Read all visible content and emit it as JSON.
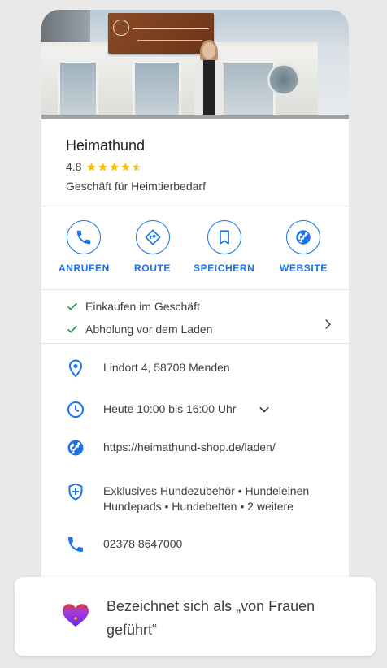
{
  "business": {
    "name": "Heimathund",
    "rating": "4.8",
    "rating_value": 4.8,
    "rating_max": 5,
    "category": "Geschäft für Heimtierbedarf"
  },
  "actions": [
    {
      "label": "ANRUFEN",
      "icon": "phone-icon"
    },
    {
      "label": "ROUTE",
      "icon": "directions-icon"
    },
    {
      "label": "SPEICHERN",
      "icon": "bookmark-icon"
    },
    {
      "label": "WEBSITE",
      "icon": "globe-icon"
    }
  ],
  "services": [
    "Einkaufen im Geschäft",
    "Abholung vor dem Laden"
  ],
  "info": {
    "address": "Lindort 4, 58708 Menden",
    "hours": "Heute 10:00 bis 16:00 Uhr",
    "website": "https://heimathund-shop.de/laden/",
    "products_line1": "Exklusives Hundezubehör • Hundeleinen",
    "products_line2": "Hundepads • Hundebetten • 2 weitere",
    "phone": "02378 8647000"
  },
  "toast": {
    "text": "Bezeichnet sich als „von Frauen geführt“",
    "icon": "heart-icon"
  },
  "colors": {
    "accent": "#1a73e8",
    "star": "#fbbc04",
    "check": "#1e8e3e",
    "heart_top": "#e53935",
    "heart_bottom": "#7b2ff7"
  }
}
